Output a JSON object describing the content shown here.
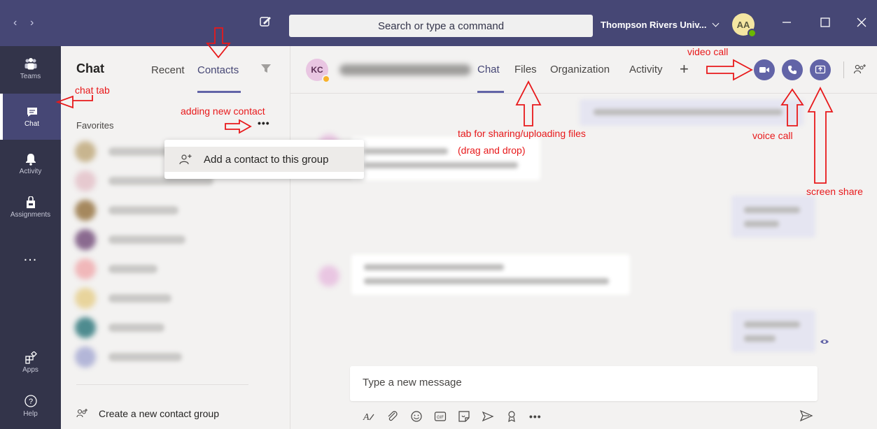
{
  "titlebar": {
    "back_icon": "chevron-left-icon",
    "forward_icon": "chevron-right-icon",
    "compose_icon": "new-chat-icon",
    "search_placeholder": "Search or type a command",
    "org_name": "Thompson Rivers Univ...",
    "user_initials": "AA",
    "window_controls": [
      "minimize-icon",
      "maximize-icon",
      "close-icon"
    ]
  },
  "rail": {
    "items": [
      {
        "label": "Teams",
        "icon": "teams-icon"
      },
      {
        "label": "Chat",
        "icon": "chat-icon",
        "active": true
      },
      {
        "label": "Activity",
        "icon": "bell-icon"
      },
      {
        "label": "Assignments",
        "icon": "assignments-icon"
      }
    ],
    "more": "...",
    "bottom_items": [
      {
        "label": "Apps",
        "icon": "apps-icon"
      },
      {
        "label": "Help",
        "icon": "help-icon"
      }
    ]
  },
  "chat_pane": {
    "title": "Chat",
    "tabs": [
      {
        "label": "Recent",
        "active": false
      },
      {
        "label": "Contacts",
        "active": true
      }
    ],
    "filter_icon": "filter-icon",
    "favorites_label": "Favorites",
    "favorites_more": "•••",
    "contact_count_blurred": 8,
    "new_group_label": "Create a new contact group"
  },
  "popup_menu": {
    "item_label": "Add a contact to this group",
    "item_icon": "add-person-icon"
  },
  "conversation": {
    "initials": "KC",
    "tabs": [
      {
        "label": "Chat",
        "active": true
      },
      {
        "label": "Files",
        "active": false
      },
      {
        "label": "Organization",
        "active": false
      },
      {
        "label": "Activity",
        "active": false
      }
    ],
    "add_tab": "+",
    "buttons": [
      "video-call-icon",
      "voice-call-icon",
      "screen-share-icon"
    ],
    "add_people_icon": "add-people-icon"
  },
  "compose": {
    "placeholder": "Type a new message",
    "tools": [
      "format-icon",
      "attach-icon",
      "emoji-icon",
      "gif-icon",
      "sticker-icon",
      "meet-now-icon",
      "praise-icon",
      "more-options-icon"
    ],
    "send_icon": "send-icon"
  },
  "annotations": {
    "chat_tab": "chat tab",
    "adding_contact": "adding new contact",
    "files_tab_line1": "tab for sharing/uploading files",
    "files_tab_line2": "(drag and drop)",
    "video_call": "video call",
    "voice_call": "voice call",
    "screen_share": "screen share"
  },
  "colors": {
    "titlebar": "#464775",
    "rail": "#33344a",
    "accent": "#6264a7",
    "annotation": "#e8191b"
  }
}
